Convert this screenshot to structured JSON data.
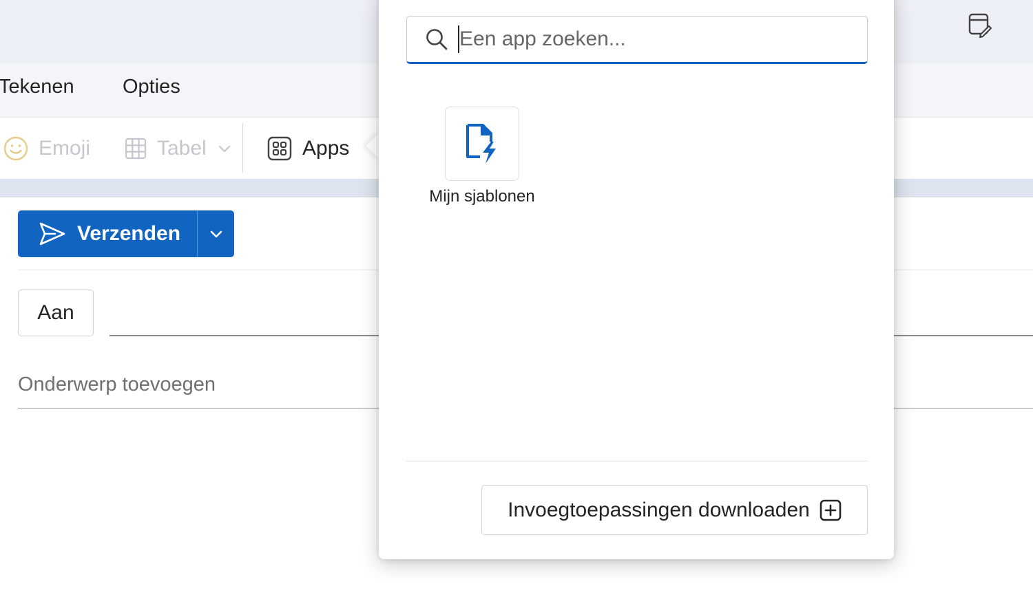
{
  "ribbon": {
    "tabs": [
      "Tekenen",
      "Opties"
    ],
    "commands": {
      "emoji": "Emoji",
      "tabel": "Tabel",
      "apps": "Apps"
    }
  },
  "compose": {
    "send_label": "Verzenden",
    "to_label": "Aan",
    "subject_placeholder": "Onderwerp toevoegen"
  },
  "apps_flyout": {
    "search_placeholder": "Een app zoeken...",
    "apps": [
      {
        "label": "Mijn sjablonen",
        "icon": "template-lightning-icon"
      }
    ],
    "download_label": "Invoegtoepassingen downloaden"
  },
  "colors": {
    "accent": "#1165c1",
    "disabled_text": "#c5c7cc"
  }
}
